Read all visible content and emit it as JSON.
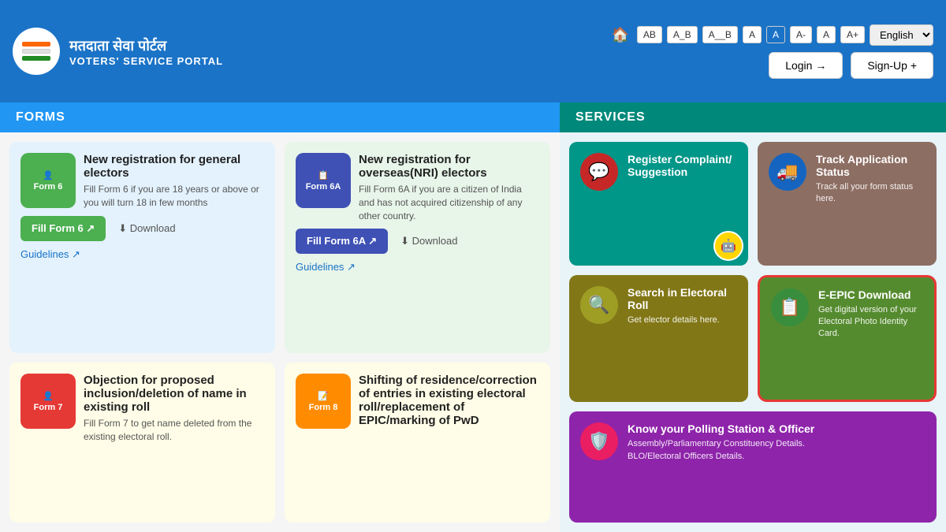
{
  "header": {
    "logo_alt": "Voters Service Portal Logo",
    "title_hindi": "मतदाता सेवा पोर्टल",
    "title_english": "VOTERS' SERVICE PORTAL",
    "font_buttons": [
      "AB",
      "A_B",
      "A__B",
      "A",
      "A",
      "A-",
      "A",
      "A+"
    ],
    "language": "English",
    "login_label": "Login →",
    "signup_label": "Sign-Up +"
  },
  "forms_section": {
    "header": "FORMS",
    "cards": [
      {
        "badge_text": "Form 6",
        "badge_color": "badge-green",
        "icon": "👤",
        "title": "New registration for general electors",
        "desc": "Fill Form 6 if you are 18 years or above or you will turn 18 in few months",
        "fill_label": "Fill Form 6 ↗",
        "fill_color": "fill-btn-green",
        "download_label": "Download",
        "guidelines_label": "Guidelines ↗",
        "bg": "card-blue"
      },
      {
        "badge_text": "Form 6A",
        "badge_color": "badge-blue",
        "icon": "📋",
        "title": "New registration for overseas(NRI) electors",
        "desc": "Fill Form 6A if you are a citizen of India and has not acquired citizenship of any other country.",
        "fill_label": "Fill Form 6A ↗",
        "fill_color": "fill-btn-blue",
        "download_label": "Download",
        "guidelines_label": "Guidelines ↗",
        "bg": "card-green"
      },
      {
        "badge_text": "Form 7",
        "badge_color": "badge-red",
        "icon": "👤",
        "title": "Objection for proposed inclusion/deletion of name in existing roll",
        "desc": "Fill Form 7 to get name deleted from the existing electoral roll.",
        "fill_label": "",
        "fill_color": "",
        "download_label": "",
        "guidelines_label": "",
        "bg": "card-yellow"
      },
      {
        "badge_text": "Form 8",
        "badge_color": "badge-orange",
        "icon": "📝",
        "title": "Shifting of residence/correction of entries in existing electoral roll/replacement of EPIC/marking of PwD",
        "desc": "",
        "fill_label": "",
        "fill_color": "",
        "download_label": "",
        "guidelines_label": "",
        "bg": "card-yellow"
      }
    ]
  },
  "services_section": {
    "header": "SERVICES",
    "cards": [
      {
        "id": "register-complaint",
        "icon": "💬",
        "icon_bg": "icon-bg-red",
        "bg": "svc-teal",
        "title": "Register Complaint/ Suggestion",
        "desc": "",
        "has_chatbot": true,
        "highlight": false
      },
      {
        "id": "track-application",
        "icon": "🚚",
        "icon_bg": "icon-bg-blue",
        "bg": "svc-brown",
        "title": "Track Application Status",
        "desc": "Track all your form status here.",
        "has_chatbot": false,
        "highlight": false
      },
      {
        "id": "search-electoral",
        "icon": "🔍",
        "icon_bg": "icon-bg-olive-light",
        "bg": "svc-olive",
        "title": "Search in Electoral Roll",
        "desc": "Get elector details here.",
        "has_chatbot": false,
        "highlight": false
      },
      {
        "id": "e-epic-download",
        "icon": "📋",
        "icon_bg": "icon-bg-green-bright",
        "bg": "svc-green-dark",
        "title": "E-EPIC Download",
        "desc": "Get digital version of your Electoral Photo Identity Card.",
        "has_chatbot": false,
        "highlight": true
      },
      {
        "id": "know-polling",
        "icon": "🛡",
        "icon_bg": "icon-bg-pink",
        "bg": "svc-purple",
        "title": "Know your Polling Station & Officer",
        "desc_line1": "Assembly/Parliamentary Constituency Details.",
        "desc_line2": "BLO/Electoral Officers Details.",
        "has_chatbot": false,
        "highlight": false,
        "full_width": true
      }
    ]
  }
}
